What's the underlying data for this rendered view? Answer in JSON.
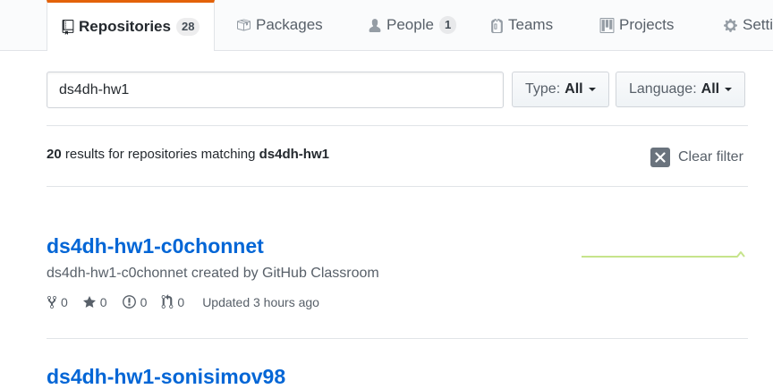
{
  "tabs": {
    "repositories": {
      "label": "Repositories",
      "count": "28"
    },
    "packages": {
      "label": "Packages"
    },
    "people": {
      "label": "People",
      "count": "1"
    },
    "teams": {
      "label": "Teams"
    },
    "projects": {
      "label": "Projects"
    },
    "settings": {
      "label": "Settings"
    }
  },
  "filter": {
    "search_value": "ds4dh-hw1",
    "type_label": "Type:",
    "type_value": "All",
    "language_label": "Language:",
    "language_value": "All"
  },
  "results": {
    "count": "20",
    "text": "results for repositories matching",
    "query": "ds4dh-hw1",
    "clear_label": "Clear filter"
  },
  "repos": [
    {
      "name": "ds4dh-hw1-c0chonnet",
      "description": "ds4dh-hw1-c0chonnet created by GitHub Classroom",
      "forks": "0",
      "stars": "0",
      "issues": "0",
      "pulls": "0",
      "updated": "Updated 3 hours ago"
    },
    {
      "name": "ds4dh-hw1-sonisimov98"
    }
  ],
  "colors": {
    "accent": "#e36209",
    "link": "#0366d6",
    "spark": "#c6e48b"
  }
}
